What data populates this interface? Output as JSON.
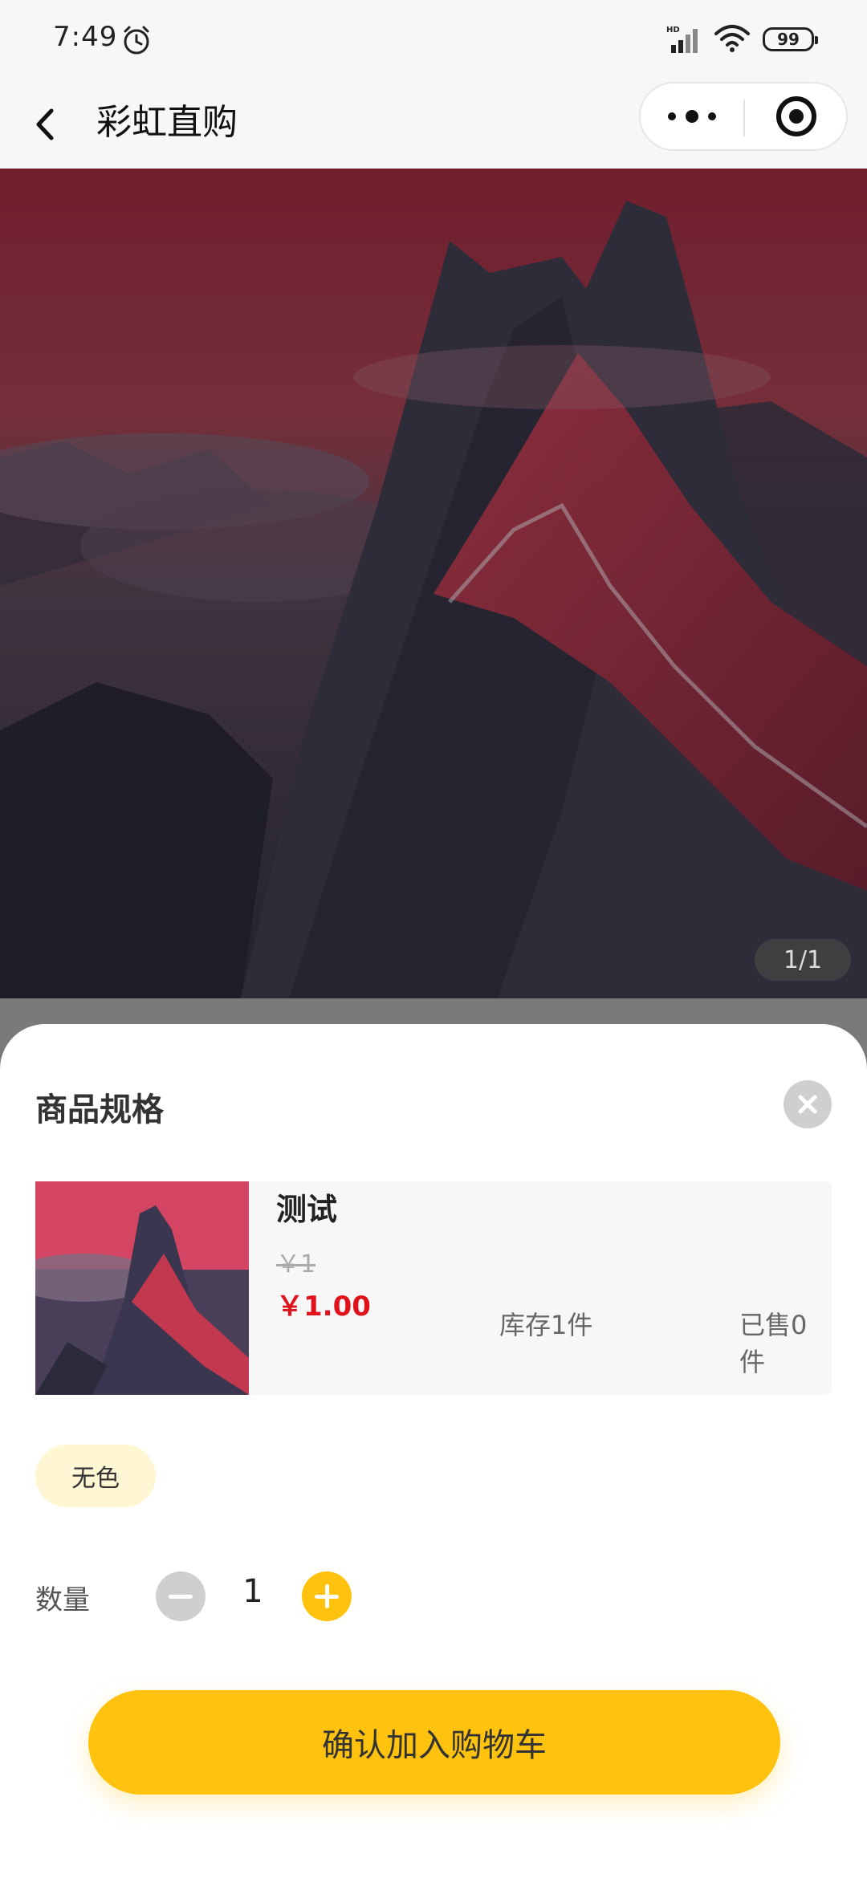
{
  "status_bar": {
    "time": "7:49",
    "battery": "99",
    "icons": [
      "alarm-icon",
      "signal-icon",
      "wifi-icon",
      "battery-icon"
    ]
  },
  "nav": {
    "title": "彩虹直购",
    "icons": [
      "back-icon",
      "more-icon",
      "target-icon"
    ]
  },
  "hero": {
    "page_indicator": "1/1"
  },
  "sheet": {
    "title": "商品规格",
    "product": {
      "name": "测试",
      "original_price": "￥1",
      "price": "￥1.00",
      "stock": "库存1件",
      "sold": "已售0件"
    },
    "spec_option": "无色",
    "quantity_label": "数量",
    "quantity": "1",
    "confirm_label": "确认加入购物车"
  },
  "colors": {
    "accent": "#ffc20e",
    "price": "#e0121b",
    "spec_bg": "#fff6d4"
  }
}
